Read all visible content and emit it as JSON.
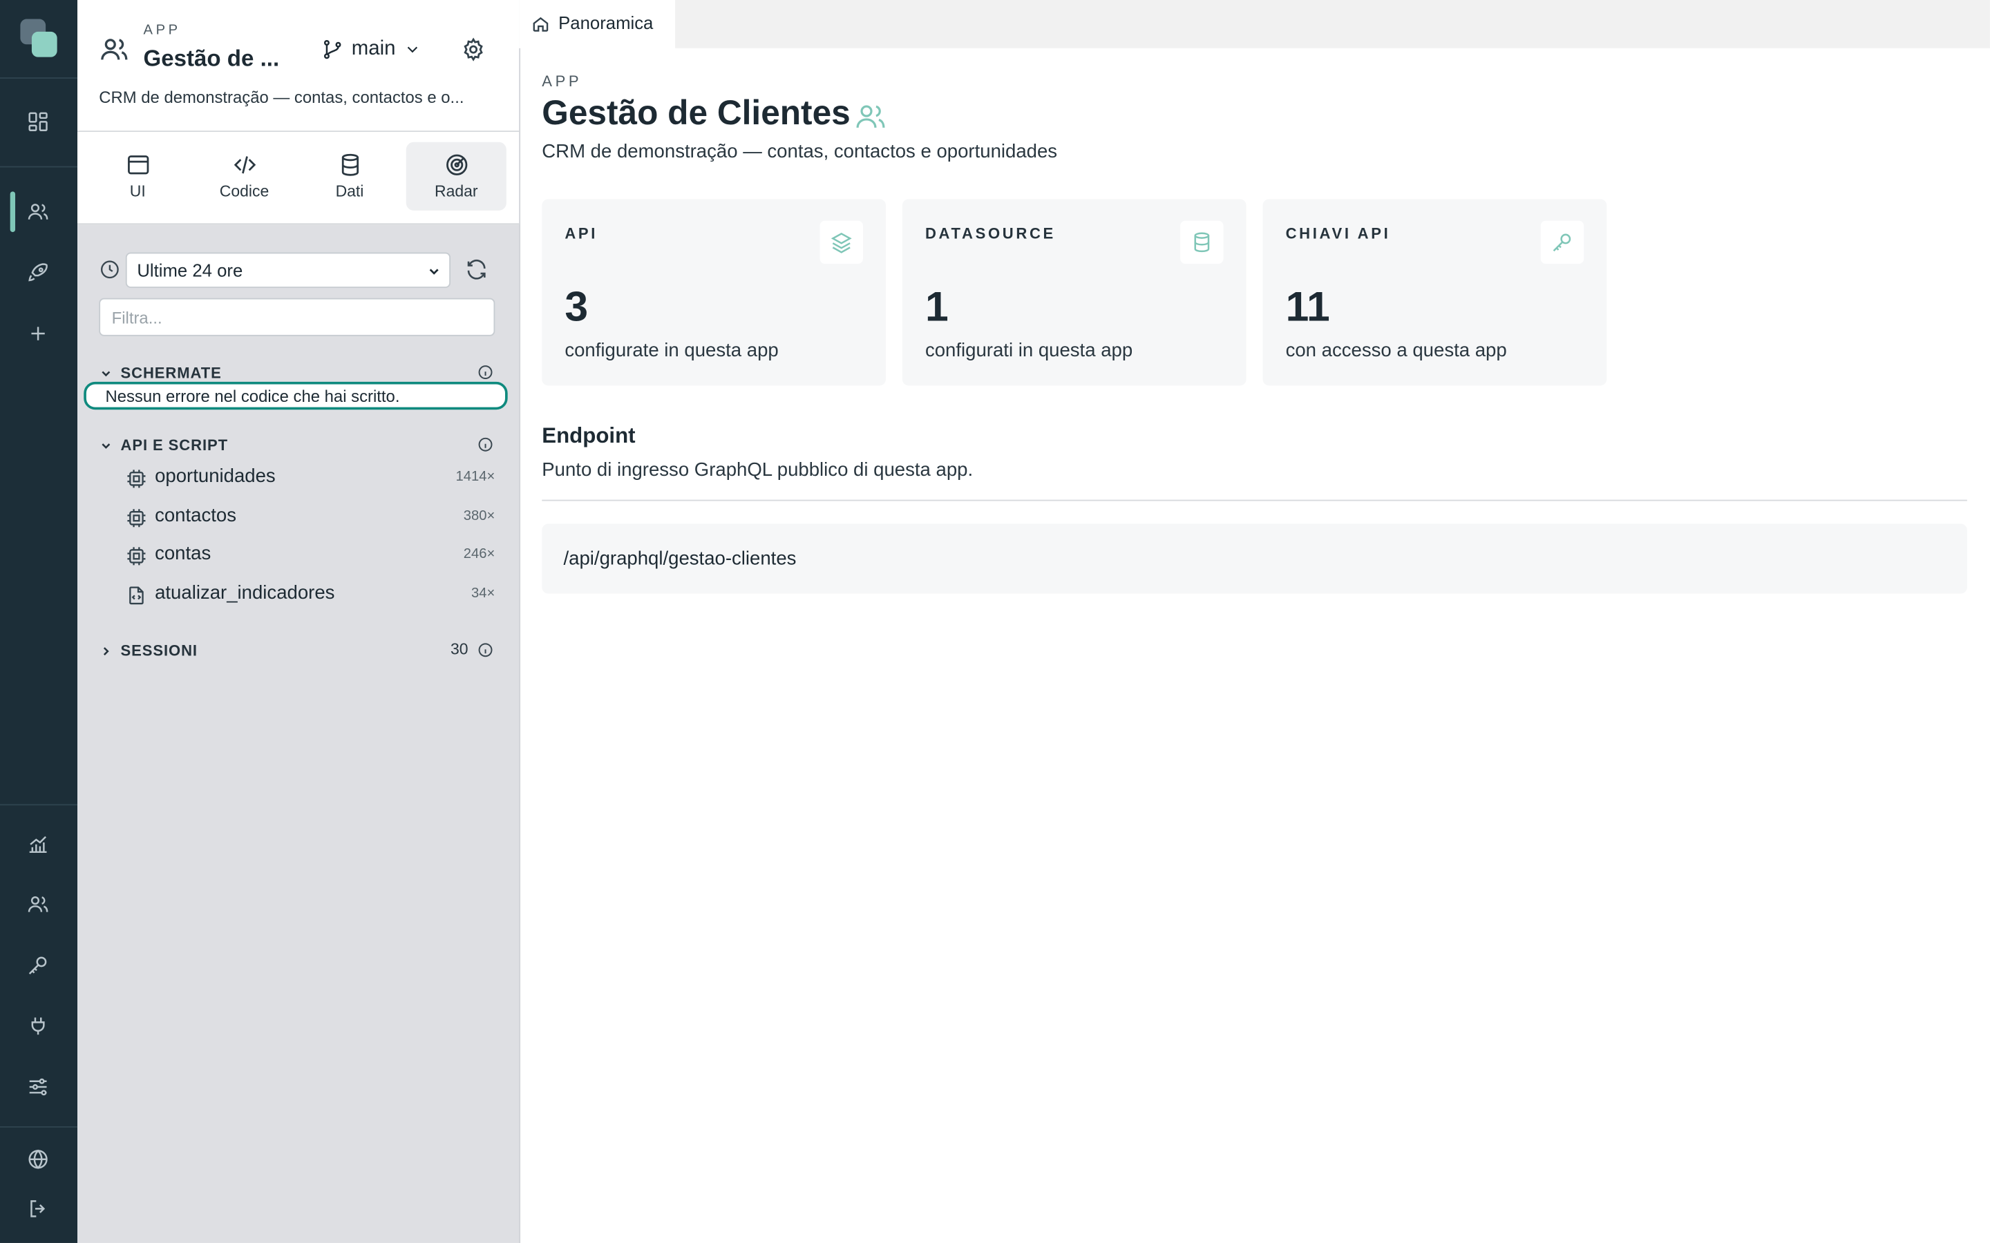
{
  "sidebar_panel": {
    "kicker": "APP",
    "title": "Gestão de ...",
    "branch": "main",
    "description": "CRM de demonstração — contas, contactos e o...",
    "tabs": [
      {
        "label": "UI"
      },
      {
        "label": "Codice"
      },
      {
        "label": "Dati"
      },
      {
        "label": "Radar"
      }
    ],
    "time_range": "Ultime 24 ore",
    "filter_placeholder": "Filtra...",
    "sections": {
      "screens": {
        "label": "SCHERMATE",
        "empty_message": "Nessun errore nel codice che hai scritto."
      },
      "api_scripts": {
        "label": "API E SCRIPT",
        "items": [
          {
            "name": "oportunidades",
            "count": "1414×",
            "icon": "chip-icon"
          },
          {
            "name": "contactos",
            "count": "380×",
            "icon": "chip-icon"
          },
          {
            "name": "contas",
            "count": "246×",
            "icon": "chip-icon"
          },
          {
            "name": "atualizar_indicadores",
            "count": "34×",
            "icon": "script-file-icon"
          }
        ]
      },
      "sessions": {
        "label": "SESSIONI",
        "count": "30"
      }
    }
  },
  "main": {
    "tab_label": "Panoramica",
    "kicker": "APP",
    "title": "Gestão de Clientes",
    "subtitle": "CRM de demonstração — contas, contactos e oportunidades",
    "cards": [
      {
        "label": "API",
        "value": "3",
        "description": "configurate in questa app",
        "icon": "layers-icon"
      },
      {
        "label": "DATASOURCE",
        "value": "1",
        "description": "configurati in questa app",
        "icon": "database-icon"
      },
      {
        "label": "CHIAVI API",
        "value": "11",
        "description": "con accesso a questa app",
        "icon": "key-icon"
      }
    ],
    "endpoint": {
      "title": "Endpoint",
      "subtitle": "Punto di ingresso GraphQL pubblico di questa app.",
      "path": "/api/graphql/gestao-clientes"
    }
  },
  "colors": {
    "rail_bg": "#1c2e38",
    "accent": "#7fc6b7",
    "focus_ring": "#0f8a7e",
    "panel_bg": "#dedfe3"
  }
}
